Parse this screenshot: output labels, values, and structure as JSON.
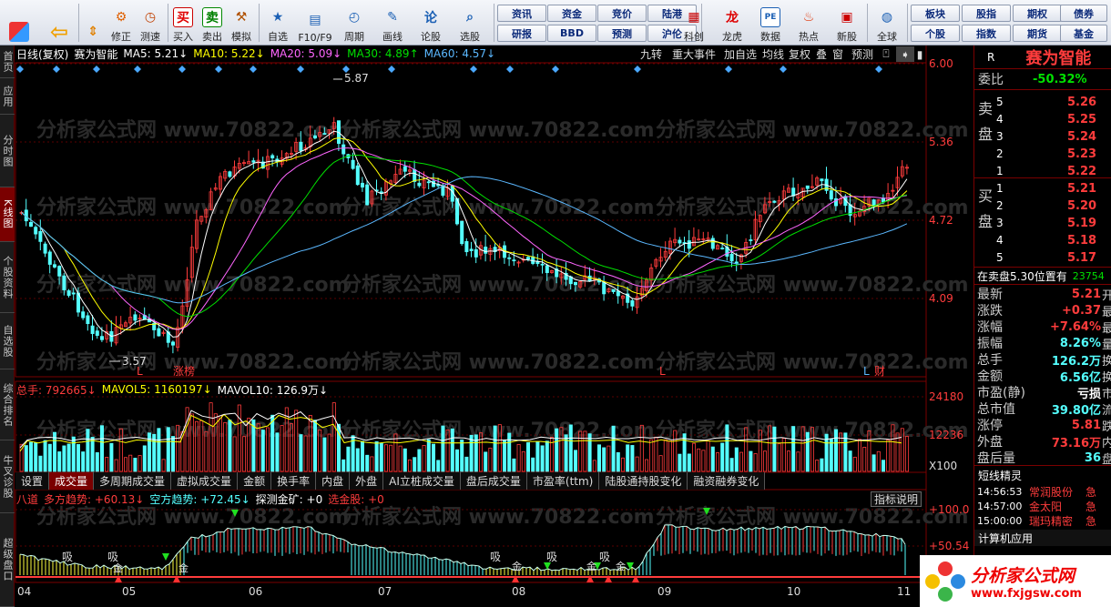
{
  "toolbar": {
    "buttons": [
      "修正",
      "测速",
      "买入",
      "卖出",
      "模拟",
      "自选",
      "F10/F9",
      "周期",
      "画线",
      "论股",
      "选股",
      "科创",
      "龙虎",
      "数据",
      "热点",
      "新股",
      "全球"
    ],
    "small_row1": [
      "资讯",
      "资金",
      "竞价",
      "陆港",
      "板块",
      "股指",
      "期权",
      "债券"
    ],
    "small_row2": [
      "研报",
      "BBD",
      "预测",
      "沪伦",
      "个股",
      "指数",
      "期货",
      "基金"
    ]
  },
  "left_tabs": [
    "首页",
    "应用",
    "分时图",
    "K线图",
    "个股资料",
    "自选股",
    "综合排名",
    "牛叉诊股",
    "超级盘口"
  ],
  "main_header": {
    "period": "日线(复权)",
    "stock": "赛为智能",
    "ma5": "MA5: 5.21↓",
    "ma10": "MA10: 5.22↓",
    "ma20": "MA20: 5.09↓",
    "ma30": "MA30: 4.89↑",
    "ma60": "MA60: 4.57↓"
  },
  "main_buttons": [
    "九转",
    "重大事件",
    "加自选",
    "均线",
    "复权",
    "叠",
    "窗",
    "预测"
  ],
  "price_axis": [
    "6.00",
    "5.36",
    "4.72",
    "4.09"
  ],
  "annotations": {
    "high": "5.87",
    "low": "3.57",
    "markers": [
      "L",
      "涨榜",
      "L",
      "L",
      "财"
    ]
  },
  "vol_header": {
    "total": "总手: 792665↓",
    "mavol5": "MAVOL5: 1160197↓",
    "mavol10": "MAVOL10: 126.9万↓"
  },
  "vol_axis": [
    "24180",
    "12236",
    "X100"
  ],
  "sub_tabs": [
    "设置",
    "成交量",
    "多周期成交量",
    "虚拟成交量",
    "金额",
    "换手率",
    "内盘",
    "外盘",
    "AI立桩成交量",
    "盘后成交量",
    "市盈率(ttm)",
    "陆股通持股变化",
    "融资融券变化"
  ],
  "ind_header": {
    "name": "八道",
    "duo": "多方趋势: +60.13↓",
    "kong": "空方趋势: +72.45↓",
    "tance": "探测金矿: +0",
    "xuan": "选金股: +0",
    "help": "指标说明"
  },
  "ind_axis": [
    "+100.0",
    "+50.54"
  ],
  "ind_labels": [
    "吸",
    "吸",
    "金",
    "金",
    "吸",
    "金",
    "吸",
    "金",
    "吸",
    "金"
  ],
  "months": [
    "04",
    "05",
    "06",
    "07",
    "08",
    "09",
    "10",
    "11"
  ],
  "watermark": "分析家公式网 www.70822.com",
  "right_panel": {
    "code_tag": "R",
    "name": "赛为智能",
    "weibi_label": "委比",
    "weibi": "-50.32%",
    "sell_label": "卖盘",
    "buy_label": "买盘",
    "sells": [
      {
        "level": "5",
        "price": "5.26"
      },
      {
        "level": "4",
        "price": "5.25"
      },
      {
        "level": "3",
        "price": "5.24"
      },
      {
        "level": "2",
        "price": "5.23"
      },
      {
        "level": "1",
        "price": "5.22"
      }
    ],
    "buys": [
      {
        "level": "1",
        "price": "5.21"
      },
      {
        "level": "2",
        "price": "5.20"
      },
      {
        "level": "3",
        "price": "5.19"
      },
      {
        "level": "4",
        "price": "5.18"
      },
      {
        "level": "5",
        "price": "5.17"
      }
    ],
    "big_order": "在卖盘5.30位置有",
    "big_order_qty": "23754",
    "stats": [
      {
        "label": "最新",
        "value": "5.21",
        "extra": "开"
      },
      {
        "label": "涨跌",
        "value": "+0.37",
        "extra": "最"
      },
      {
        "label": "涨幅",
        "value": "+7.64%",
        "extra": "最"
      },
      {
        "label": "振幅",
        "value": "8.26%",
        "extra": "量"
      },
      {
        "label": "总手",
        "value": "126.2万",
        "extra": "换"
      },
      {
        "label": "金额",
        "value": "6.56亿",
        "extra": "换"
      },
      {
        "label": "市盈(静)",
        "value": "亏损",
        "extra": "市"
      },
      {
        "label": "总市值",
        "value": "39.80亿",
        "extra": "流"
      },
      {
        "label": "涨停",
        "value": "5.81",
        "extra": "跌"
      },
      {
        "label": "外盘",
        "value": "73.16万",
        "extra": "内"
      },
      {
        "label": "盘后量",
        "value": "36",
        "extra": "盘"
      }
    ],
    "short_title": "短线精灵",
    "short_items": [
      {
        "time": "14:56:53",
        "name": "常润股份",
        "tag": "急"
      },
      {
        "time": "14:57:00",
        "name": "金太阳",
        "tag": "急"
      },
      {
        "time": "15:00:00",
        "name": "瑞玛精密",
        "tag": "急"
      }
    ],
    "calc_title": "计算机应用"
  },
  "brand": {
    "name": "分析家公式网",
    "url": "www.fxjgsw.com"
  },
  "colors": {
    "up": "#ff3c3c",
    "down": "#54ffff",
    "ma5": "#ffffff",
    "ma10": "#ffff00",
    "ma20": "#ff66ff",
    "ma30": "#00e000",
    "ma60": "#5bb8ff"
  }
}
